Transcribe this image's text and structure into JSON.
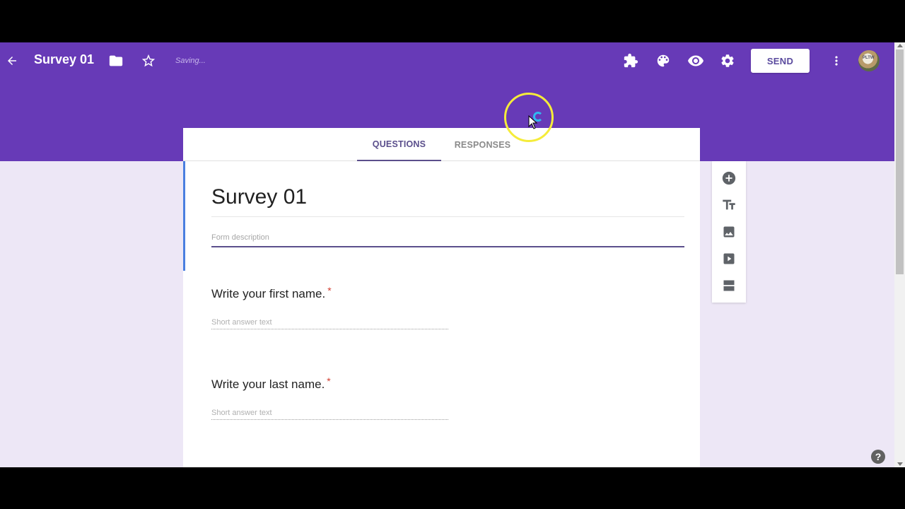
{
  "header": {
    "title": "Survey 01",
    "status": "Saving...",
    "send_label": "SEND",
    "avatar_text": "PLTW",
    "icons": [
      "back-arrow-icon",
      "folder-icon",
      "star-icon",
      "addons-icon",
      "palette-icon",
      "eye-icon",
      "gear-icon",
      "more-vert-icon"
    ]
  },
  "tabs": [
    {
      "label": "QUESTIONS",
      "active": true
    },
    {
      "label": "RESPONSES",
      "active": false
    }
  ],
  "form": {
    "title": "Survey 01",
    "description_placeholder": "Form description",
    "questions": [
      {
        "title": "Write your first name.",
        "required_mark": "*",
        "answer_placeholder": "Short answer text"
      },
      {
        "title": "Write your last name.",
        "required_mark": "*",
        "answer_placeholder": "Short answer text"
      }
    ]
  },
  "side_toolbar": {
    "items": [
      "add-question-icon",
      "add-title-icon",
      "add-image-icon",
      "add-video-icon",
      "add-section-icon"
    ]
  },
  "help": {
    "label": "?"
  },
  "colors": {
    "brand": "#673ab7",
    "background": "#ede7f6",
    "accent": "#5b4f8c",
    "focus_border": "#4a7fe0",
    "required": "#d23f31"
  }
}
